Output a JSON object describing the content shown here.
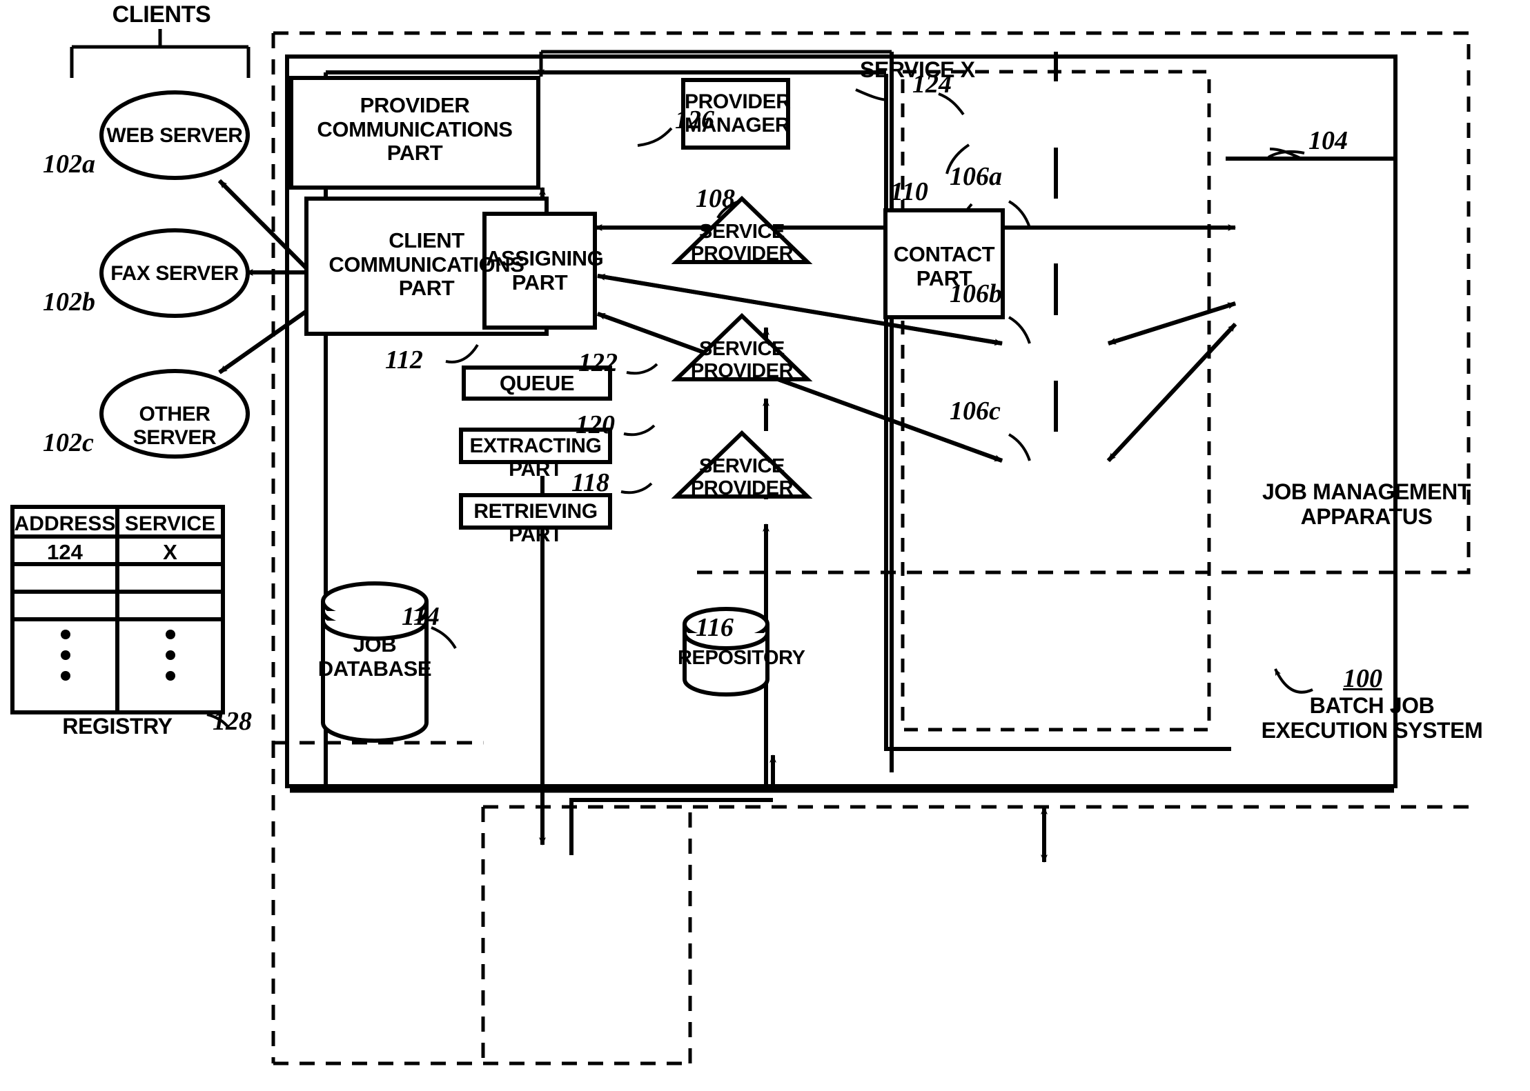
{
  "diagram": {
    "title_label": "CLIENTS",
    "service_x_label": "SERVICE X",
    "job_mgmt_label_line1": "JOB MANAGEMENT",
    "job_mgmt_label_line2": "APPARATUS",
    "batch_label_line1": "BATCH JOB",
    "batch_label_line2": "EXECUTION SYSTEM",
    "batch_ref": "100",
    "registry_caption": "REGISTRY",
    "registry_ref": "128"
  },
  "clients": [
    {
      "label": "WEB SERVER",
      "ref": "102a"
    },
    {
      "label": "FAX SERVER",
      "ref": "102b"
    },
    {
      "label": "OTHER SERVER",
      "ref": "102c"
    }
  ],
  "registry": {
    "columns": [
      "ADDRESS",
      "SERVICE"
    ],
    "rows": [
      [
        "124",
        "X"
      ],
      [
        "",
        ""
      ],
      [
        "",
        ""
      ],
      [
        "⋮",
        "⋮"
      ]
    ]
  },
  "boxes": {
    "provider_comm": {
      "line1": "PROVIDER",
      "line2": "COMMUNICATIONS",
      "line3": "PART",
      "ref": "126"
    },
    "client_comm": {
      "line1": "CLIENT",
      "line2": "COMMUNICATIONS",
      "line3": "PART",
      "ref": "112"
    },
    "assigning": {
      "line1": "ASSIGNING",
      "line2": "PART",
      "ref": "108"
    },
    "queue": {
      "line1": "QUEUE",
      "ref": "122"
    },
    "extracting": {
      "line1": "EXTRACTING PART",
      "ref": "120"
    },
    "retrieving": {
      "line1": "RETRIEVING PART",
      "ref": "118"
    },
    "provider_manager": {
      "line1": "PROVIDER",
      "line2": "MANAGER",
      "ref": "124"
    },
    "contact": {
      "line1": "CONTACT",
      "line2": "PART",
      "ref": "110"
    },
    "contact_outer_ref": "104"
  },
  "providers": [
    {
      "line1": "SERVICE",
      "line2": "PROVIDER",
      "ref": "106a"
    },
    {
      "line1": "SERVICE",
      "line2": "PROVIDER",
      "ref": "106b"
    },
    {
      "line1": "SERVICE",
      "line2": "PROVIDER",
      "ref": "106c"
    }
  ],
  "stores": [
    {
      "line1": "JOB",
      "line2": "DATABASE",
      "ref": "114"
    },
    {
      "line1": "REPOSITORY",
      "line2": "",
      "ref": "116"
    }
  ],
  "colors": {
    "ink": "#000000",
    "paper": "#ffffff"
  }
}
